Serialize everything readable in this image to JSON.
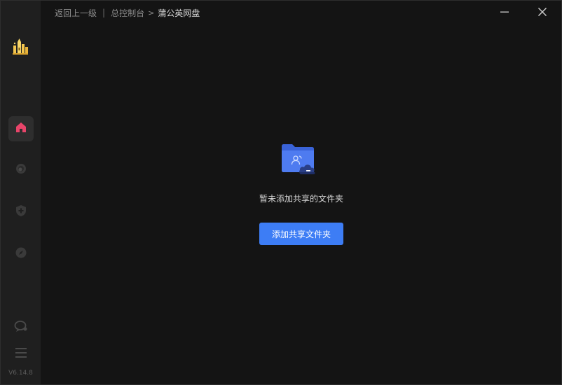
{
  "breadcrumb": {
    "back_label": "返回上一级",
    "separator": "|",
    "parent_label": "总控制台",
    "chevron": ">",
    "current_label": "蒲公英网盘"
  },
  "window_controls": {
    "minimize_icon": "minimize-icon",
    "close_icon": "close-icon"
  },
  "sidebar": {
    "logo_icon": "castle-logo-icon",
    "items": [
      {
        "icon": "home-icon",
        "active": true
      },
      {
        "icon": "globe-icon",
        "active": false
      },
      {
        "icon": "shield-plus-icon",
        "active": false
      },
      {
        "icon": "compass-icon",
        "active": false
      }
    ],
    "bottom": [
      {
        "icon": "chat-icon"
      },
      {
        "icon": "menu-icon"
      }
    ],
    "version": "V6.14.8"
  },
  "empty_state": {
    "icon": "shared-folder-cloud-icon",
    "message": "暂未添加共享的文件夹",
    "button_label": "添加共享文件夹"
  },
  "colors": {
    "accent": "#3d7df5",
    "home_icon": "#e8456a",
    "sidebar_bg": "#1f1f1f",
    "main_bg": "#141414"
  }
}
